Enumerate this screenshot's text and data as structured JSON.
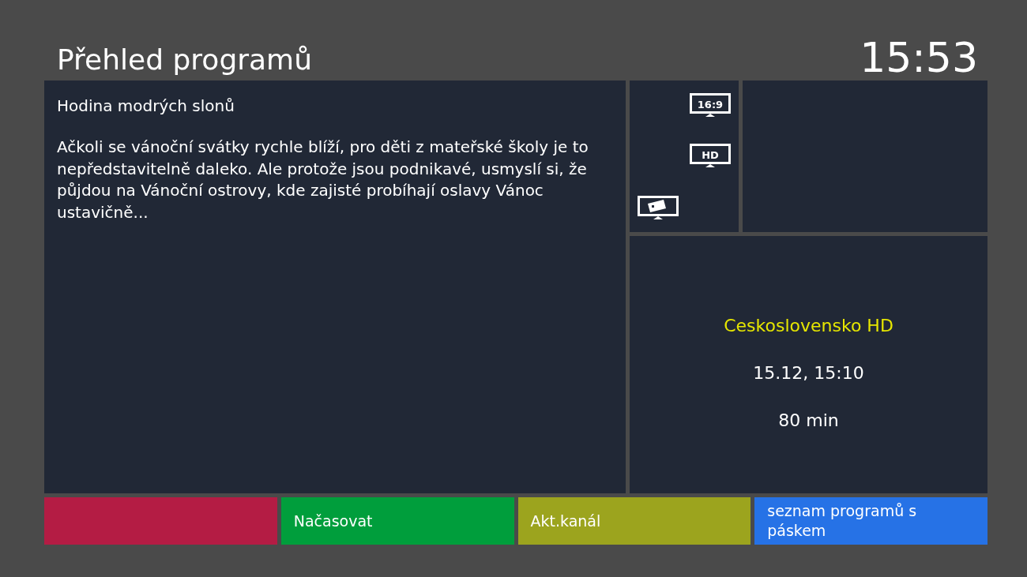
{
  "header": {
    "title": "Přehled programů",
    "clock": "15:53"
  },
  "description": {
    "title": "Hodina modrých slonů",
    "text": "Ačkoli se vánoční svátky rychle blíží, pro děti z mateřské školy je to nepředstavitelně daleko. Ale protože jsou podnikavé, usmyslí si, že půjdou na Vánoční ostrovy, kde zajisté probíhají oslavy Vánoc ustavičně..."
  },
  "badges": [
    {
      "kind": "text",
      "label": "16:9"
    },
    {
      "kind": "text",
      "label": "HD"
    },
    {
      "kind": "card"
    }
  ],
  "info": {
    "channel": "Ceskoslovensko HD",
    "datetime": "15.12, 15:10",
    "duration": "80 min"
  },
  "buttons": [
    {
      "color": "#b41c44"
    },
    {
      "label": "Načasovat",
      "color": "#009e3c"
    },
    {
      "label": "Akt.kanál",
      "color": "#9ca41e"
    },
    {
      "label": "seznam programů s páskem",
      "color": "#2672e6"
    }
  ]
}
